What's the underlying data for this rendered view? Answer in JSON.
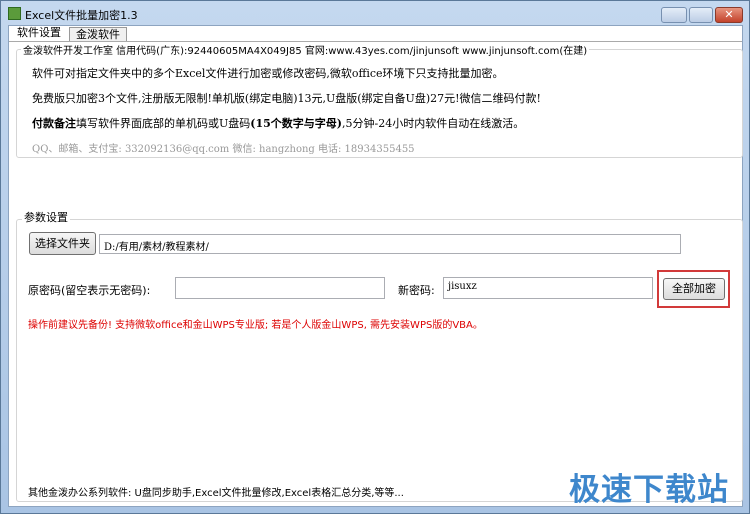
{
  "window": {
    "title": "Excel文件批量加密1.3",
    "minimize": "—",
    "maximize": "□",
    "close": "✕"
  },
  "tabs": [
    {
      "label": "软件设置",
      "active": true
    },
    {
      "label": "金泼软件",
      "active": false
    }
  ],
  "info": {
    "group_label": "金泼软件开发工作室 信用代码(广东):92440605MA4X049J85 官网:www.43yes.com/jinjunsoft  www.jinjunsoft.com(在建)",
    "line1": "软件可对指定文件夹中的多个Excel文件进行加密或修改密码,微软office环境下只支持批量加密。",
    "line2": "免费版只加密3个文件,注册版无限制!单机版(绑定电脑)13元,U盘版(绑定自备U盘)27元!微信二维码付款!",
    "line3_bold": "付款备注",
    "line3_a": "填写软件界面底部的单机码或U盘码",
    "line3_bold2": "(15个数字与字母)",
    "line3_b": ",5分钟-24小时内软件自动在线激活。",
    "contact": "QQ、邮箱、支付宝: 332092136@qq.com    微信: hangzhong    电话: 18934355455"
  },
  "params": {
    "group_label": "参数设置",
    "choose_folder": "选择文件夹",
    "folder_path": "D:/有用/素材/教程素材/",
    "old_pw_label": "原密码(留空表示无密码):",
    "old_pw_value": "",
    "new_pw_label": "新密码:",
    "new_pw_value": "jisuxz",
    "encrypt_all": "全部加密",
    "warning": "操作前建议先备份! 支持微软office和金山WPS专业版; 若是个人版金山WPS, 需先安装WPS版的VBA。"
  },
  "footer": "其他金泼办公系列软件: U盘同步助手,Excel文件批量修改,Excel表格汇总分类,等等...",
  "watermark": "极速下载站",
  "colors": {
    "warning": "#dd0000",
    "highlight": "#d23a3a",
    "watermark": "#3e87cc"
  }
}
